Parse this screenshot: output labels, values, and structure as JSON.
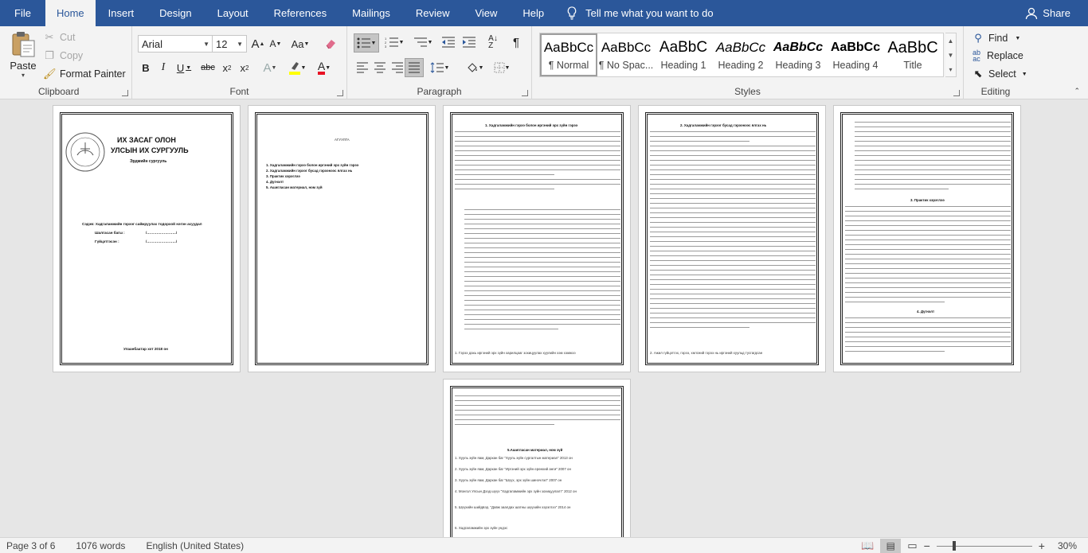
{
  "menu": {
    "tabs": [
      "File",
      "Home",
      "Insert",
      "Design",
      "Layout",
      "References",
      "Mailings",
      "Review",
      "View",
      "Help"
    ],
    "active_tab": "Home",
    "tell_me": "Tell me what you want to do",
    "share": "Share"
  },
  "clipboard": {
    "paste": "Paste",
    "cut": "Cut",
    "copy": "Copy",
    "format_painter": "Format Painter",
    "label": "Clipboard"
  },
  "font": {
    "family": "Arial",
    "size": "12",
    "grow": "A",
    "shrink": "A",
    "case": "Aa",
    "bold": "B",
    "italic": "I",
    "underline": "U",
    "strike": "abc",
    "subscript": "x",
    "superscript": "x",
    "label": "Font"
  },
  "paragraph": {
    "label": "Paragraph",
    "pilcrow": "¶"
  },
  "styles": {
    "label": "Styles",
    "items": [
      {
        "sample": "AaBbCc",
        "name": "¶ Normal"
      },
      {
        "sample": "AaBbCc",
        "name": "¶ No Spac..."
      },
      {
        "sample": "AaBbC",
        "name": "Heading 1"
      },
      {
        "sample": "AaBbCc",
        "name": "Heading 2"
      },
      {
        "sample": "AaBbCc",
        "name": "Heading 3"
      },
      {
        "sample": "AaBbCc",
        "name": "Heading 4"
      },
      {
        "sample": "AaBbC",
        "name": "Title"
      }
    ]
  },
  "editing": {
    "find": "Find",
    "replace": "Replace",
    "select": "Select",
    "label": "Editing"
  },
  "pages": {
    "p1": {
      "title1": "ИХ ЗАСАГ ОЛОН",
      "title2": "УЛСЫН ИХ СУРГУУЛЬ",
      "subtitle": "Эрдмийн сургууль",
      "topic": "Сэдэв: Хадгаламжийн гэрээг сайжруулах тодорхой нэгэн асуудал",
      "checked": "Шалгасан багш :",
      "done": "Гүйцэтгэсэн :",
      "blank": "/……………………/",
      "footer": "Улаанбаатар хот  2018 он"
    },
    "p2": {
      "heading": "АГУУЛГА",
      "toc": [
        "1.  Хадгаламжийн гэрээ болон иргэний эрх зүйн гэрээ",
        "2.  Хадгаламжийн гэрээг бусад гэрээнээс ялгах нь",
        "3.  Практик хэрэглээ",
        "4.  Дүгнэлт",
        "5.  Ашигласан материал, ном зүй"
      ]
    },
    "p3": {
      "heading": "1. Хадгаламжийн гэрээ болон иргэний эрх зүйн гэрээ",
      "footnote": "1. Гэрээ дахь иргэний эрх зүйн харилцааг зохицуулах хуулийн хэм хэмжээ"
    },
    "p4": {
      "heading": "2. Хадгаламжийн гэрээг бусад гэрээнээс ялгах нь",
      "footnote": "2. Ажил гүйцэтгэх, гэрээ, хөлсний гэрээ нь иргэний хуульд тусгагдсан"
    },
    "p5": {
      "heading3": "3. Практик хэрэглээ",
      "heading4": "4. Дүгнэлт"
    },
    "p6": {
      "heading": "5.Ашигласан материал, ном зүй",
      "refs": [
        "1. Хууль зүйн яам, Дархан баг \"Хууль зүйн сургалтын материал\" 2013 он",
        "2. Хууль зүйн яам, Дархан баг \"Иргэний эрх зүйн ерөнхий анги\" 2007 он",
        "3. Хууль зүйн яам, Дархан баг \"Шүүх, эрх зүйн шинэчлэл\" 2007 он",
        "4. Монгол Улсын Дээд шүүх \"Хадгаламжийн эрх зүйн зохицуулалт\" 2012 он",
        "5. Шүүхийн шийдвэр, \"Давж заалдах шатны шүүхийн хэрэглээ\" 2014 он",
        "6. Хадгаламжийн эрх зүйн үндэс"
      ]
    }
  },
  "status": {
    "page": "Page 3 of 6",
    "words": "1076 words",
    "language": "English (United States)",
    "zoom": "30%"
  }
}
